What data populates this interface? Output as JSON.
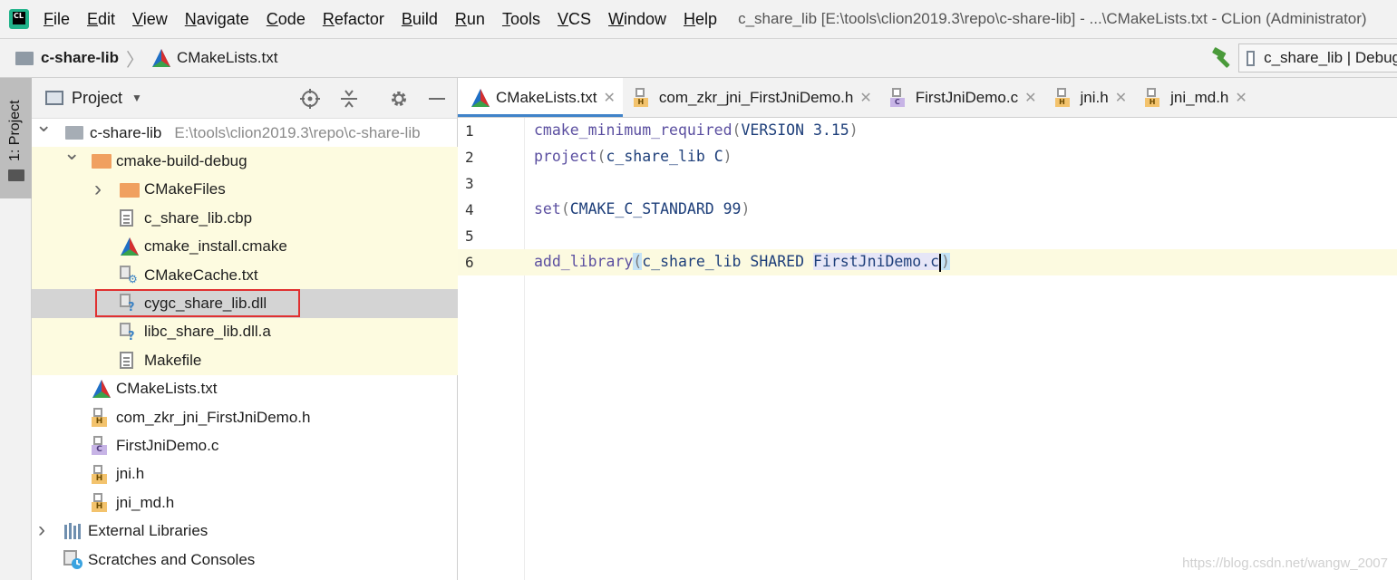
{
  "menubar": {
    "app_icon_text": "CL",
    "items": [
      {
        "u": "F",
        "rest": "ile"
      },
      {
        "u": "E",
        "rest": "dit"
      },
      {
        "u": "V",
        "rest": "iew"
      },
      {
        "u": "N",
        "rest": "avigate"
      },
      {
        "u": "C",
        "rest": "ode"
      },
      {
        "u": "R",
        "rest": "efactor"
      },
      {
        "u": "B",
        "rest": "uild"
      },
      {
        "u": "R",
        "rest": "un"
      },
      {
        "u": "T",
        "rest": "ools"
      },
      {
        "u": "V",
        "rest": "CS"
      },
      {
        "u": "W",
        "rest": "indow"
      },
      {
        "u": "H",
        "rest": "elp"
      }
    ],
    "window_title": "c_share_lib [E:\\tools\\clion2019.3\\repo\\c-share-lib] - ...\\CMakeLists.txt - CLion (Administrator)"
  },
  "navbar": {
    "root": "c-share-lib",
    "separator": "〉",
    "file": "CMakeLists.txt",
    "run_config": "c_share_lib | Debug"
  },
  "side_stripe": {
    "tab_label": "1: Project"
  },
  "project_panel": {
    "title": "Project",
    "caret": "▼",
    "tree": [
      {
        "label": "c-share-lib",
        "path": "E:\\tools\\clion2019.3\\repo\\c-share-lib",
        "icon": "folder-gray-icon",
        "arrow": "expanded",
        "indent": 0,
        "bg": "white"
      },
      {
        "label": "cmake-build-debug",
        "icon": "folder-orange-icon",
        "arrow": "expanded",
        "indent": 1,
        "bg": "yellow"
      },
      {
        "label": "CMakeFiles",
        "icon": "folder-orange-icon",
        "arrow": "collapsed",
        "indent": 2,
        "bg": "yellow"
      },
      {
        "label": "c_share_lib.cbp",
        "icon": "text-file-icon",
        "indent": 2,
        "bg": "yellow"
      },
      {
        "label": "cmake_install.cmake",
        "icon": "cmake-icon",
        "indent": 2,
        "bg": "yellow"
      },
      {
        "label": "CMakeCache.txt",
        "icon": "settings-file-icon",
        "indent": 2,
        "bg": "yellow"
      },
      {
        "label": "cygc_share_lib.dll",
        "icon": "unknown-file-icon",
        "indent": 2,
        "bg": "selected",
        "highlighted": true
      },
      {
        "label": "libc_share_lib.dll.a",
        "icon": "unknown-file-icon",
        "indent": 2,
        "bg": "yellow"
      },
      {
        "label": "Makefile",
        "icon": "text-file-icon",
        "indent": 2,
        "bg": "yellow"
      },
      {
        "label": "CMakeLists.txt",
        "icon": "cmake-icon",
        "indent": 1,
        "bg": "white"
      },
      {
        "label": "com_zkr_jni_FirstJniDemo.h",
        "icon": "header-file-icon",
        "indent": 1,
        "bg": "white"
      },
      {
        "label": "FirstJniDemo.c",
        "icon": "c-file-icon",
        "indent": 1,
        "bg": "white"
      },
      {
        "label": "jni.h",
        "icon": "header-file-icon",
        "indent": 1,
        "bg": "white"
      },
      {
        "label": "jni_md.h",
        "icon": "header-file-icon",
        "indent": 1,
        "bg": "white"
      },
      {
        "label": "External Libraries",
        "icon": "libraries-icon",
        "arrow": "collapsed",
        "indent": 0,
        "bg": "white"
      },
      {
        "label": "Scratches and Consoles",
        "icon": "scratches-icon",
        "indent": 0,
        "bg": "white"
      }
    ]
  },
  "editor": {
    "tabs": [
      {
        "label": "CMakeLists.txt",
        "icon": "cmake-icon",
        "active": true
      },
      {
        "label": "com_zkr_jni_FirstJniDemo.h",
        "icon": "header-file-icon",
        "badge": "H"
      },
      {
        "label": "FirstJniDemo.c",
        "icon": "c-file-icon",
        "badge": "C"
      },
      {
        "label": "jni.h",
        "icon": "header-file-icon",
        "badge": "H"
      },
      {
        "label": "jni_md.h",
        "icon": "header-file-icon",
        "badge": "H"
      }
    ],
    "close_glyph": "✕",
    "lines": [
      {
        "num": "1",
        "cmd": "cmake_minimum_required",
        "args": "VERSION 3.15"
      },
      {
        "num": "2",
        "cmd": "project",
        "args": "c_share_lib C"
      },
      {
        "num": "3"
      },
      {
        "num": "4",
        "cmd": "set",
        "args": "CMAKE_C_STANDARD 99"
      },
      {
        "num": "5"
      },
      {
        "num": "6",
        "cmd": "add_library",
        "args_a": "c_share_lib SHARED ",
        "args_b": "FirstJniDemo.c",
        "current": true
      }
    ]
  },
  "watermark": "https://blog.csdn.net/wangw_2007",
  "colors": {
    "yellow_row": "#fdfbe0",
    "selected_row": "#d4d4d4",
    "highlight_border": "#e03030",
    "active_tab_underline": "#4083c9",
    "keyword": "#5b4fa0",
    "argument": "#1e3f7a"
  }
}
